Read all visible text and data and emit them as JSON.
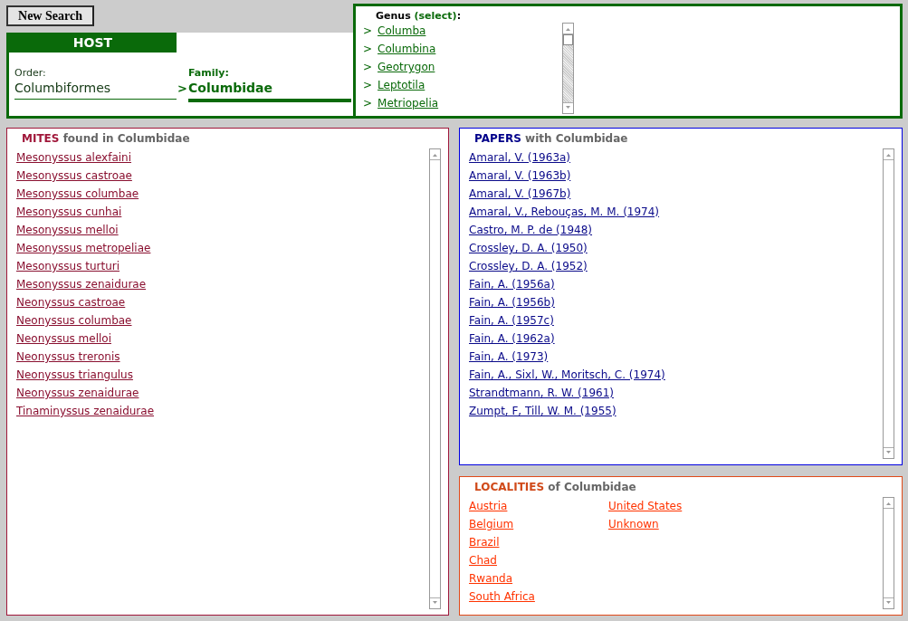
{
  "new_search_button": "New Search",
  "host": {
    "title": "HOST",
    "order": {
      "label": "Order:",
      "value": "Columbiformes"
    },
    "family": {
      "label": "Family:",
      "marker": ">",
      "value": "Columbidae"
    }
  },
  "genus": {
    "label": "Genus",
    "hint": "(select)",
    "suffix": ":",
    "items": [
      {
        "marker": ">",
        "name": "Columba"
      },
      {
        "marker": ">",
        "name": "Columbina"
      },
      {
        "marker": ">",
        "name": "Geotrygon"
      },
      {
        "marker": ">",
        "name": "Leptotila"
      },
      {
        "marker": ">",
        "name": "Metriopelia"
      }
    ]
  },
  "mites": {
    "keyword": "MITES",
    "rest": "found in Columbidae",
    "items": [
      "Mesonyssus alexfaini",
      "Mesonyssus castroae",
      "Mesonyssus columbae",
      "Mesonyssus cunhai",
      "Mesonyssus melloi",
      "Mesonyssus metropeliae",
      "Mesonyssus turturi",
      "Mesonyssus zenaidurae",
      "Neonyssus castroae",
      "Neonyssus columbae",
      "Neonyssus melloi",
      "Neonyssus treronis",
      "Neonyssus triangulus",
      "Neonyssus zenaidurae",
      "Tinaminyssus zenaidurae"
    ]
  },
  "papers": {
    "keyword": "PAPERS",
    "rest": "with Columbidae",
    "items": [
      "Amaral, V. (1963a)",
      "Amaral, V. (1963b)",
      "Amaral, V. (1967b)",
      "Amaral, V., Rebouças, M. M. (1974)",
      "Castro, M. P. de (1948)",
      "Crossley, D. A. (1950)",
      "Crossley, D. A. (1952)",
      "Fain, A. (1956a)",
      "Fain, A. (1956b)",
      "Fain, A. (1957c)",
      "Fain, A. (1962a)",
      "Fain, A. (1973)",
      "Fain, A., Sixl, W., Moritsch, C. (1974)",
      "Strandtmann, R. W. (1961)",
      "Zumpt, F, Till, W. M. (1955)"
    ]
  },
  "localities": {
    "keyword": "LOCALITIES",
    "rest": "of Columbidae",
    "items": [
      "Austria",
      "Belgium",
      "Brazil",
      "Chad",
      "Rwanda",
      "South Africa",
      "United States",
      "Unknown"
    ]
  }
}
